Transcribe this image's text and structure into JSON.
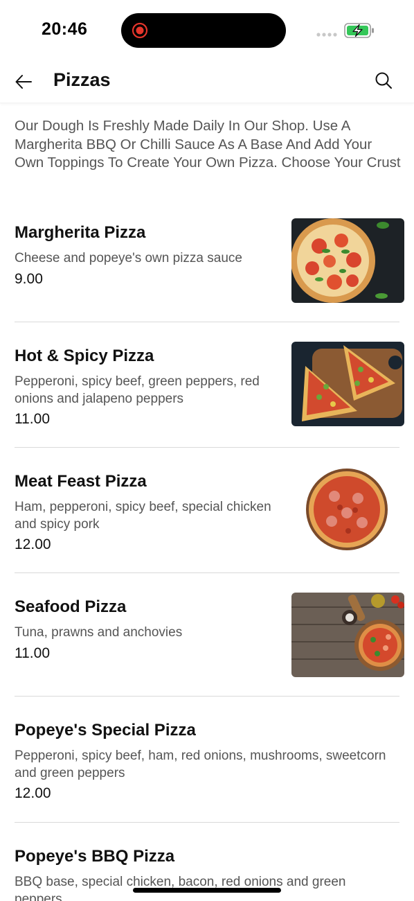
{
  "status_bar": {
    "time": "20:46"
  },
  "header": {
    "title": "Pizzas",
    "back_icon": "arrow-left-icon",
    "search_icon": "search-icon"
  },
  "category": {
    "description": "Our Dough Is Freshly Made Daily In Our Shop. Use A Margherita BBQ Or Chilli Sauce As A Base And Add Your Own Toppings To Create Your Own Pizza. Choose Your Crust"
  },
  "items": [
    {
      "name": "Margherita Pizza",
      "description": "Cheese and popeye's own pizza sauce",
      "price": "9.00",
      "image": "margherita-pizza-photo"
    },
    {
      "name": "Hot & Spicy Pizza",
      "description": "Pepperoni, spicy beef, green peppers, red onions and jalapeno peppers",
      "price": "11.00",
      "image": "hot-spicy-pizza-photo"
    },
    {
      "name": "Meat Feast Pizza",
      "description": "Ham, pepperoni, spicy beef, special chicken and spicy pork",
      "price": "12.00",
      "image": "meat-feast-pizza-photo"
    },
    {
      "name": "Seafood Pizza",
      "description": "Tuna, prawns and anchovies",
      "price": "11.00",
      "image": "seafood-pizza-photo"
    },
    {
      "name": "Popeye's Special Pizza",
      "description": "Pepperoni, spicy beef, ham, red onions, mushrooms, sweetcorn and green peppers",
      "price": "12.00"
    },
    {
      "name": "Popeye's BBQ Pizza",
      "description": "BBQ base, special chicken, bacon, red onions and green peppers"
    }
  ],
  "colors": {
    "text_primary": "#111111",
    "text_secondary": "#555555",
    "divider": "#d9d9d9",
    "recording_red": "#e5352b",
    "battery_green": "#35c759"
  }
}
